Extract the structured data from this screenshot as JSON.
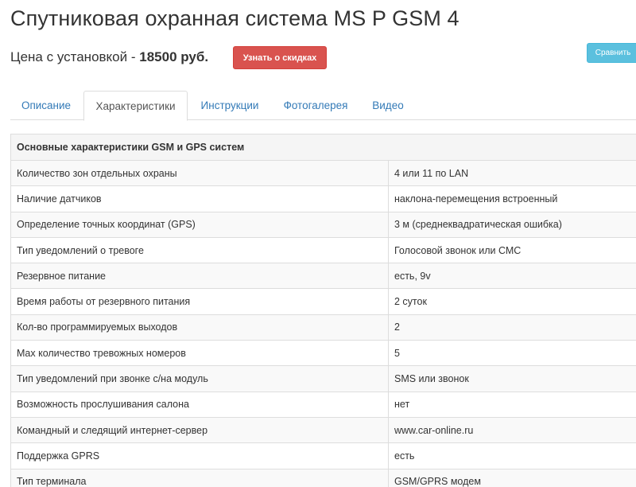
{
  "header": {
    "title": "Спутниковая охранная система MS P GSM 4",
    "price_label": "Цена с установкой - ",
    "price_value": "18500 руб.",
    "discount_button": "Узнать о скидках",
    "compare_button": "Сравнить"
  },
  "tabs": [
    {
      "label": "Описание",
      "active": false
    },
    {
      "label": "Характеристики",
      "active": true
    },
    {
      "label": "Инструкции",
      "active": false
    },
    {
      "label": "Фотогалерея",
      "active": false
    },
    {
      "label": "Видео",
      "active": false
    }
  ],
  "specs": {
    "section_title": "Основные характеристики GSM и GPS систем",
    "rows": [
      {
        "name": "Количество зон отдельных охраны",
        "value": "4 или 11 по LAN"
      },
      {
        "name": "Наличие датчиков",
        "value": "наклона-перемещения встроенный"
      },
      {
        "name": "Определение точных координат (GPS)",
        "value": "3 м (среднеквадратическая ошибка)"
      },
      {
        "name": "Тип уведомлений о тревоге",
        "value": "Голосовой звонок или СМС"
      },
      {
        "name": "Резервное питание",
        "value": "есть, 9v"
      },
      {
        "name": "Время работы от резервного питания",
        "value": "2 суток"
      },
      {
        "name": "Кол-во программируемых выходов",
        "value": "2"
      },
      {
        "name": "Max количество тревожных номеров",
        "value": "5"
      },
      {
        "name": "Тип уведомлений при звонке с/на модуль",
        "value": "SMS или звонок"
      },
      {
        "name": "Возможность прослушивания салона",
        "value": "нет"
      },
      {
        "name": "Командный и следящий интернет-сервер",
        "value": "www.car-online.ru"
      },
      {
        "name": "Поддержка GPRS",
        "value": "есть"
      },
      {
        "name": "Тип терминала",
        "value": "GSM/GPRS модем"
      }
    ]
  },
  "colors": {
    "discount_button": "#d9534f",
    "compare_button": "#5bc0de",
    "tab_link": "#337ab7"
  }
}
